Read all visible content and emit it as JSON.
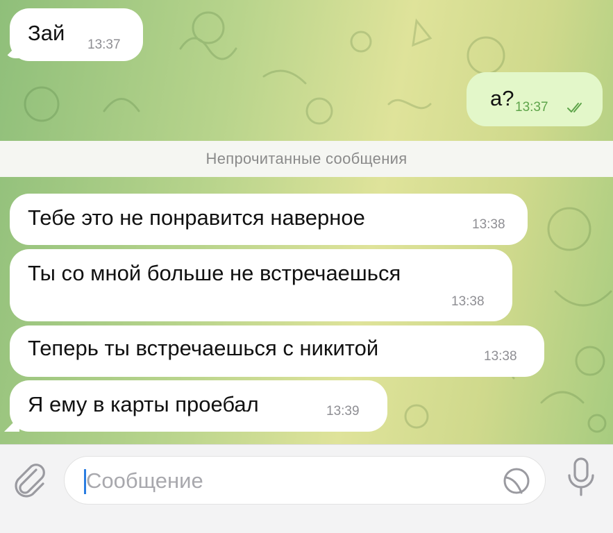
{
  "messages": {
    "m1": {
      "text": "Зай",
      "time": "13:37"
    },
    "m2": {
      "text": "а?",
      "time": "13:37"
    },
    "m3": {
      "text": "Тебе это не понравится наверное",
      "time": "13:38"
    },
    "m4": {
      "text": "Ты со мной больше не встречаешься",
      "time": "13:38"
    },
    "m5": {
      "text": "Теперь ты встречаешься с никитой",
      "time": "13:38"
    },
    "m6": {
      "text": "Я ему в карты проебал",
      "time": "13:39"
    }
  },
  "unread_divider": "Непрочитанные сообщения",
  "composer": {
    "placeholder": "Сообщение",
    "attach_icon": "paperclip-icon",
    "sticker_icon": "sticker-icon",
    "mic_icon": "microphone-icon"
  },
  "colors": {
    "outgoing_bubble": "#e3f7c9",
    "incoming_bubble": "#ffffff",
    "read_check": "#5ea44a",
    "caret": "#2a7de1"
  }
}
